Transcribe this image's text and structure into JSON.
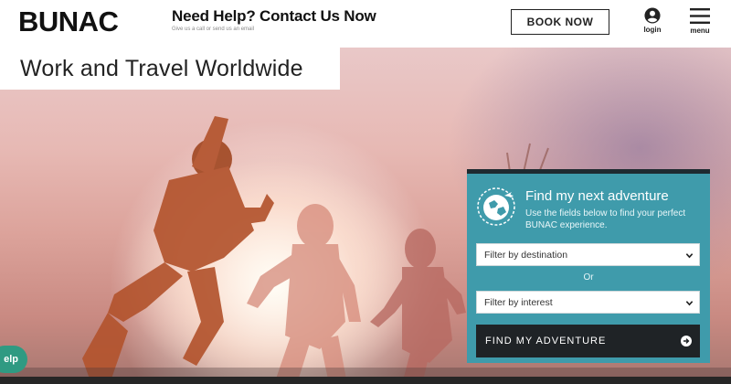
{
  "header": {
    "logo": "BUNAC",
    "help_title": "Need Help? Contact Us Now",
    "help_sub": "Give us a call or send us an email",
    "book_label": "BOOK NOW",
    "login_label": "login",
    "menu_label": "menu"
  },
  "hero": {
    "title": "Work and Travel Worldwide"
  },
  "adventure": {
    "title": "Find my next adventure",
    "description": "Use the fields below to find your perfect BUNAC experience.",
    "destination_select": "Filter by destination",
    "or_label": "Or",
    "interest_select": "Filter by interest",
    "button_label": "FIND MY ADVENTURE"
  },
  "help_bubble": {
    "label": "elp"
  },
  "colors": {
    "panel": "#3f9bab",
    "button": "#1f2326",
    "help_bubble": "#2f9a82"
  }
}
